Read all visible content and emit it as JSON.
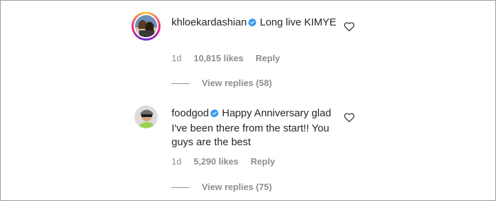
{
  "comments": [
    {
      "username": "khloekardashian",
      "verified": true,
      "text": "Long live KIMYE",
      "time": "1d",
      "likes": "10,815 likes",
      "reply_label": "Reply",
      "view_replies": "View replies (58)",
      "avatar_icon": "profile-photo-icon",
      "has_story_ring": true
    },
    {
      "username": "foodgod",
      "verified": true,
      "text": "Happy Anniversary glad I've been there from the start!! You guys are the best",
      "time": "1d",
      "likes": "5,290 likes",
      "reply_label": "Reply",
      "view_replies": "View replies (75)",
      "avatar_icon": "profile-photo-icon",
      "has_story_ring": false
    }
  ],
  "colors": {
    "text": "#262626",
    "muted": "#8e8e8e",
    "verified_blue": "#3897f0",
    "story_ring": [
      "#f9ce34",
      "#ee2a7b",
      "#6228d7"
    ]
  },
  "icons": {
    "verified": "verified-badge-icon",
    "like": "heart-outline-icon"
  }
}
